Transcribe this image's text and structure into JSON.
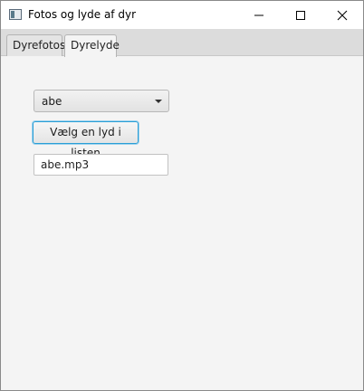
{
  "window": {
    "title": "Fotos og lyde af dyr"
  },
  "tabs": [
    {
      "label": "Dyrefotos",
      "selected": false
    },
    {
      "label": "Dyrelyde",
      "selected": true
    }
  ],
  "sound_panel": {
    "animal_select_value": "abe",
    "choose_sound_label": "Vælg en lyd i listen",
    "sound_file_value": "abe.mp3"
  }
}
